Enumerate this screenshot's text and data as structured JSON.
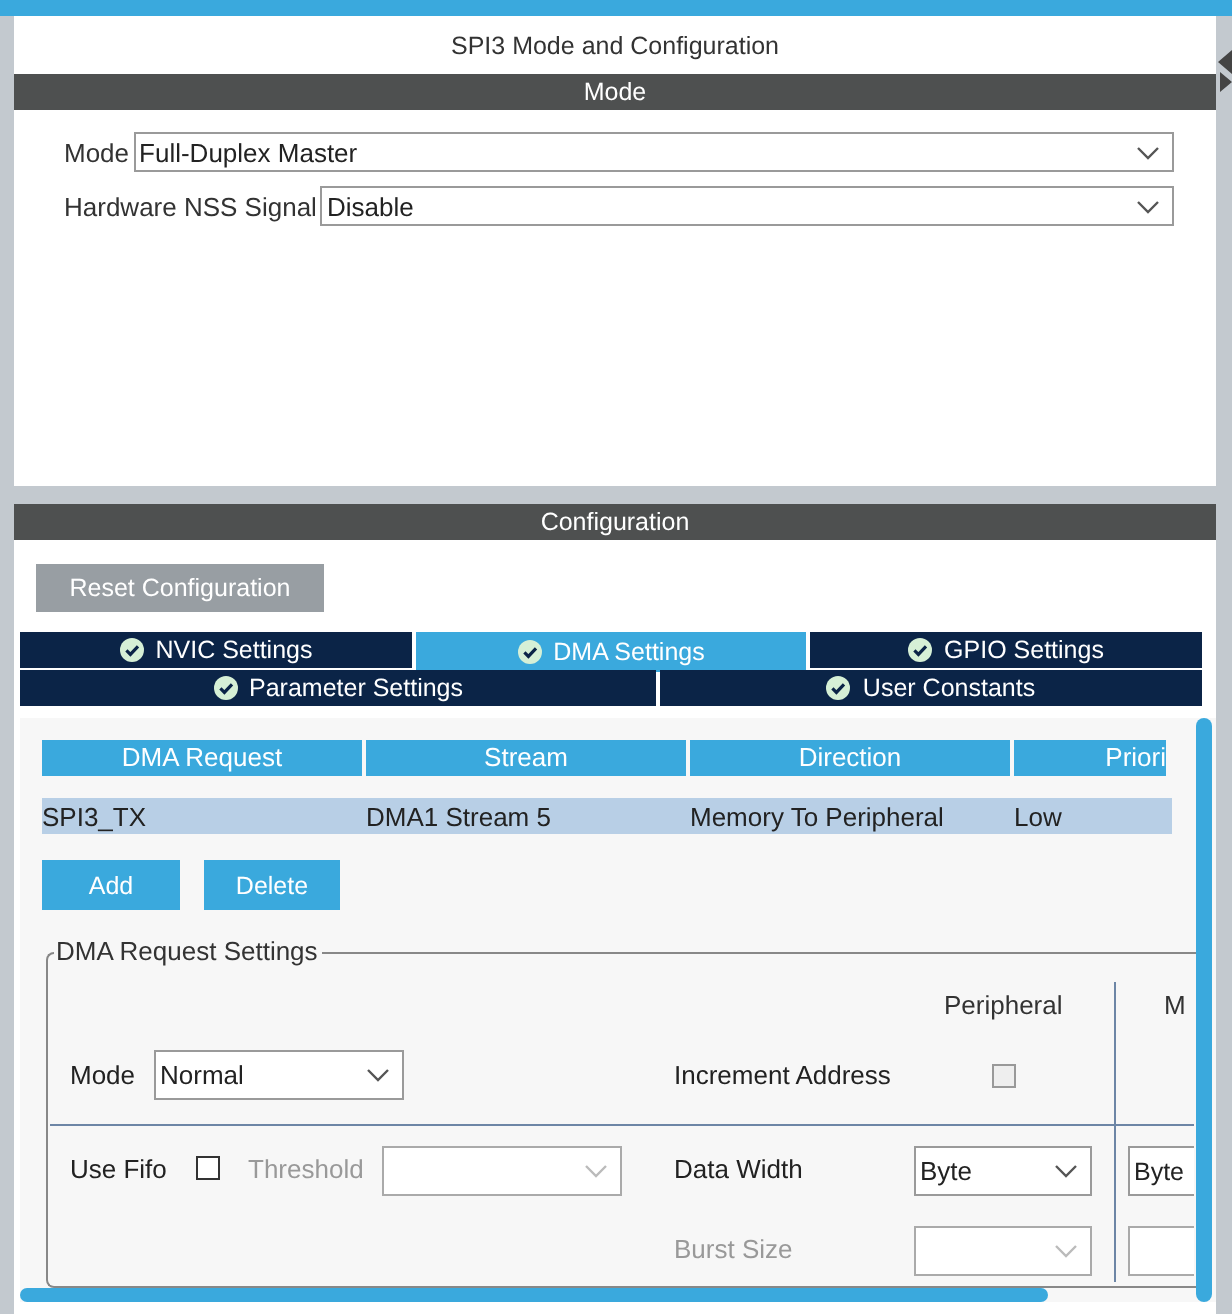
{
  "dialog": {
    "title": "SPI3 Mode and Configuration"
  },
  "mode_section": {
    "title": "Mode",
    "fields": [
      {
        "label": "Mode",
        "value": "Full-Duplex Master"
      },
      {
        "label": "Hardware NSS Signal",
        "value": "Disable"
      }
    ]
  },
  "configuration_section": {
    "title": "Configuration",
    "reset_button": "Reset Configuration",
    "tab_rows": [
      [
        {
          "label": "NVIC Settings",
          "selected": false
        },
        {
          "label": "DMA Settings",
          "selected": true
        },
        {
          "label": "GPIO Settings",
          "selected": false
        }
      ],
      [
        {
          "label": "Parameter Settings",
          "selected": false
        },
        {
          "label": "User Constants",
          "selected": false
        }
      ]
    ]
  },
  "dma_table": {
    "columns": [
      "DMA Request",
      "Stream",
      "Direction",
      "Priori"
    ],
    "rows": [
      {
        "cells": [
          "SPI3_TX",
          "DMA1 Stream 5",
          "Memory To Peripheral",
          "Low"
        ],
        "selected": true
      }
    ]
  },
  "buttons": [
    "Add",
    "Delete"
  ],
  "request_settings": {
    "title": "DMA Request Settings",
    "peripheral_header": "Peripheral",
    "memory_header": "M",
    "mode": {
      "label": "Mode",
      "value": "Normal"
    },
    "increment_address": {
      "label": "Increment Address",
      "peripheral_checked": false
    },
    "use_fifo": {
      "label": "Use Fifo",
      "checked": false
    },
    "threshold": {
      "label": "Threshold",
      "disabled": true
    },
    "data_width": {
      "label": "Data Width",
      "peripheral": "Byte",
      "memory": "Byte"
    },
    "burst_size": {
      "label": "Burst Size",
      "disabled": true
    }
  }
}
